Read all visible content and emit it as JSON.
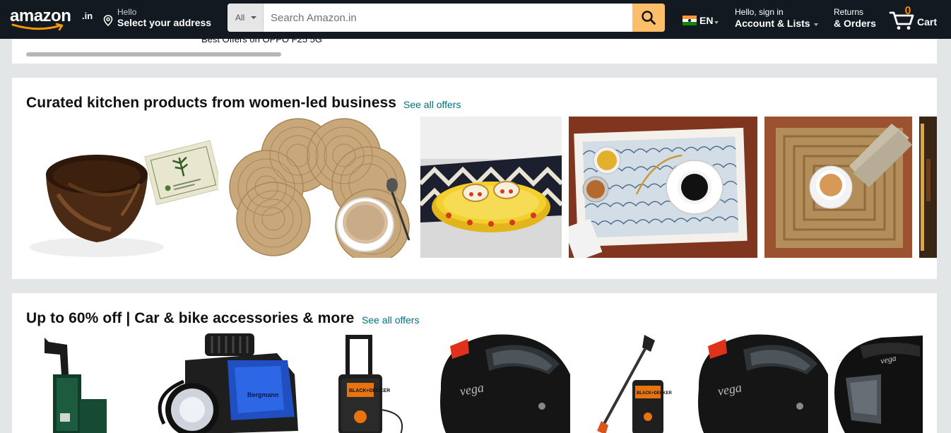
{
  "header": {
    "logo_text": "amazon",
    "logo_suffix": ".in",
    "deliver_line1": "Hello",
    "deliver_line2": "Select your address",
    "search_category": "All",
    "search_placeholder": "Search Amazon.in",
    "language": "EN",
    "account_line1": "Hello, sign in",
    "account_line2": "Account & Lists",
    "orders_line1": "Returns",
    "orders_line2": "& Orders",
    "cart_count": "0",
    "cart_label": "Cart"
  },
  "top_card": {
    "caption": "Best Offers on OPPO F25 5G"
  },
  "kitchen_card": {
    "title": "Curated kitchen products from women-led business",
    "see_all": "See all offers",
    "products": [
      {
        "name": "coconut-bowl-product"
      },
      {
        "name": "jute-coaster-set-product"
      },
      {
        "name": "yellow-serving-tray-product"
      },
      {
        "name": "mosaic-serving-tray-product"
      },
      {
        "name": "woven-placemat-product"
      },
      {
        "name": "partial-product"
      }
    ]
  },
  "car_card": {
    "title": "Up to 60% off | Car & bike accessories & more",
    "see_all": "See all offers",
    "products": [
      {
        "name": "green-pressure-washer-product"
      },
      {
        "name": "tyre-inflator-product",
        "brand": "Bergmann"
      },
      {
        "name": "black-decker-pressure-washer-product",
        "brand": "BLACK+DECKER"
      },
      {
        "name": "vega-helmet-product",
        "brand": "vega"
      },
      {
        "name": "spray-gun-washer-product",
        "brand": "BLACK+DECKER"
      },
      {
        "name": "vega-helmet-product-2",
        "brand": "vega"
      },
      {
        "name": "offroad-helmet-product",
        "brand": "vega"
      }
    ]
  },
  "colors": {
    "header_bg": "#131921",
    "search_button": "#febd69",
    "cart_count": "#f08804",
    "link": "#007185",
    "page_bg": "#e3e6e6"
  }
}
